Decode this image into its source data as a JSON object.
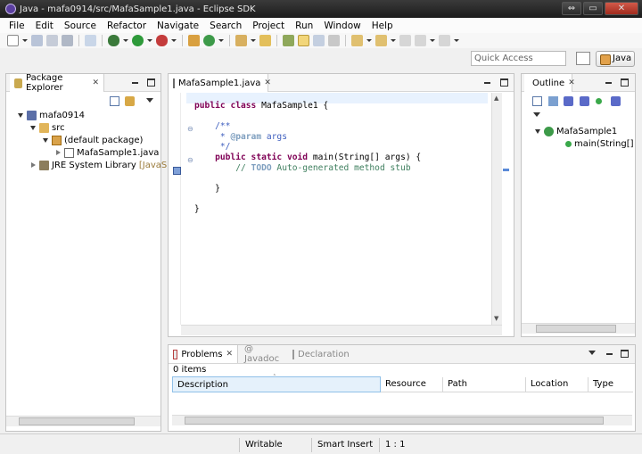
{
  "window": {
    "title": "Java - mafa0914/src/MafaSample1.java - Eclipse SDK"
  },
  "menu": [
    "File",
    "Edit",
    "Source",
    "Refactor",
    "Navigate",
    "Search",
    "Project",
    "Run",
    "Window",
    "Help"
  ],
  "quick_access": {
    "placeholder": "Quick Access"
  },
  "perspective": {
    "label": "Java"
  },
  "package_explorer": {
    "tab": "Package Explorer",
    "tree": {
      "project": "mafa0914",
      "src": "src",
      "package": "(default package)",
      "file": "MafaSample1.java",
      "library": "JRE System Library",
      "library_decoration": "[JavaSE-"
    }
  },
  "editor": {
    "tab": "MafaSample1.java",
    "code": {
      "l1_kw1": "public",
      "l1_kw2": "class",
      "l1_name": "MafaSample1 {",
      "l3": "/**",
      "l4_star": " * ",
      "l4_tag": "@param",
      "l4_text": " args",
      "l5": " */",
      "l6_kw1": "public",
      "l6_kw2": "static",
      "l6_kw3": "void",
      "l6_rest": "main(String[] args) {",
      "l7_slash": "// ",
      "l7_todo": "TODO",
      "l7_text": " Auto-generated method stub",
      "l9": "}",
      "l11": "}"
    }
  },
  "outline": {
    "tab": "Outline",
    "class_name": "MafaSample1",
    "method": "main(String[]"
  },
  "bottom_panel": {
    "tabs": {
      "problems": "Problems",
      "javadoc": "@ Javadoc",
      "declaration": "Declaration"
    },
    "count": "0 items",
    "columns": [
      "Description",
      "Resource",
      "Path",
      "Location",
      "Type"
    ]
  },
  "status": {
    "writable": "Writable",
    "insert_mode": "Smart Insert",
    "position": "1 : 1"
  }
}
